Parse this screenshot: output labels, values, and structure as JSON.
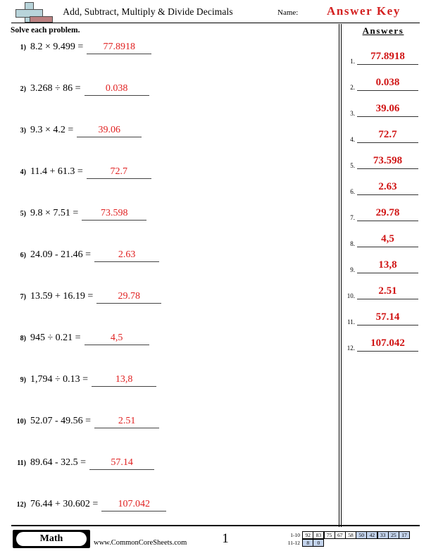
{
  "header": {
    "logo_icon": "plus-bar-logo",
    "title": "Add, Subtract, Multiply & Divide Decimals",
    "name_label": "Name:",
    "answer_key_text": "Answer Key"
  },
  "instructions": "Solve each problem.",
  "problems": [
    {
      "number": "1)",
      "expression": "8.2 × 9.499 =",
      "answer": "77.8918"
    },
    {
      "number": "2)",
      "expression": "3.268 ÷ 86 =",
      "answer": "0.038"
    },
    {
      "number": "3)",
      "expression": "9.3 × 4.2 =",
      "answer": "39.06"
    },
    {
      "number": "4)",
      "expression": "11.4 + 61.3 =",
      "answer": "72.7"
    },
    {
      "number": "5)",
      "expression": "9.8 × 7.51 =",
      "answer": "73.598"
    },
    {
      "number": "6)",
      "expression": "24.09 - 21.46 =",
      "answer": "2.63"
    },
    {
      "number": "7)",
      "expression": "13.59 + 16.19 =",
      "answer": "29.78"
    },
    {
      "number": "8)",
      "expression": "945 ÷ 0.21 =",
      "answer": "4,5"
    },
    {
      "number": "9)",
      "expression": "1,794 ÷ 0.13 =",
      "answer": "13,8"
    },
    {
      "number": "10)",
      "expression": "52.07 - 49.56 =",
      "answer": "2.51"
    },
    {
      "number": "11)",
      "expression": "89.64 - 32.5 =",
      "answer": "57.14"
    },
    {
      "number": "12)",
      "expression": "76.44 + 30.602 =",
      "answer": "107.042"
    }
  ],
  "answers_panel": {
    "heading": "Answers",
    "rows": [
      {
        "number": "1.",
        "value": "77.8918"
      },
      {
        "number": "2.",
        "value": "0.038"
      },
      {
        "number": "3.",
        "value": "39.06"
      },
      {
        "number": "4.",
        "value": "72.7"
      },
      {
        "number": "5.",
        "value": "73.598"
      },
      {
        "number": "6.",
        "value": "2.63"
      },
      {
        "number": "7.",
        "value": "29.78"
      },
      {
        "number": "8.",
        "value": "4,5"
      },
      {
        "number": "9.",
        "value": "13,8"
      },
      {
        "number": "10.",
        "value": "2.51"
      },
      {
        "number": "11.",
        "value": "57.14"
      },
      {
        "number": "12.",
        "value": "107.042"
      }
    ]
  },
  "footer": {
    "subject_badge": "Math",
    "site_url": "www.CommonCoreSheets.com",
    "page_number": "1",
    "score_table": {
      "rows": [
        {
          "label": "1-10",
          "cells": [
            {
              "value": "92",
              "shaded": false
            },
            {
              "value": "83",
              "shaded": false
            },
            {
              "value": "75",
              "shaded": false
            },
            {
              "value": "67",
              "shaded": false
            },
            {
              "value": "58",
              "shaded": false
            },
            {
              "value": "50",
              "shaded": true
            },
            {
              "value": "42",
              "shaded": true
            },
            {
              "value": "33",
              "shaded": true
            },
            {
              "value": "25",
              "shaded": true
            },
            {
              "value": "17",
              "shaded": true
            }
          ]
        },
        {
          "label": "11-12",
          "cells": [
            {
              "value": "8",
              "shaded": true
            },
            {
              "value": "0",
              "shaded": true
            }
          ]
        }
      ]
    }
  },
  "colors": {
    "answer_red": "#e02020",
    "answer_key_red": "#d42020",
    "score_shade_blue": "#c3d3ec",
    "logo_blue": "#b8d4da",
    "logo_red": "#bb8080"
  }
}
